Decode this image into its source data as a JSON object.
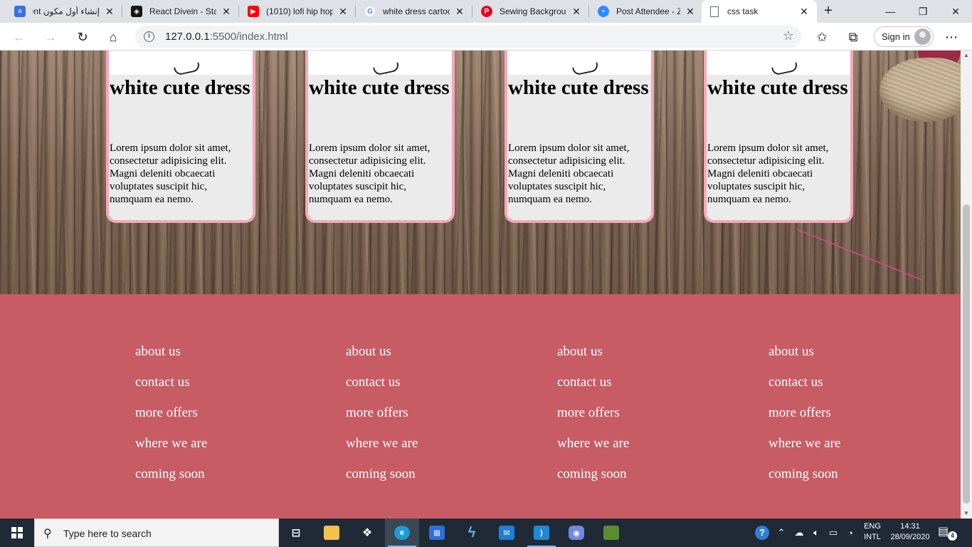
{
  "browser": {
    "tabs": [
      {
        "title": "إنشاء أول مكون ent",
        "icon": "form-builder-icon",
        "color": "#3b6fe0"
      },
      {
        "title": "React Divein - Star",
        "icon": "codesandbox-icon",
        "color": "#151515"
      },
      {
        "title": "(1010) lofi hip hop",
        "icon": "youtube-icon",
        "color": "#ff0000"
      },
      {
        "title": "white dress cartoo",
        "icon": "google-icon",
        "color": "#4285f4"
      },
      {
        "title": "Sewing Backgroun",
        "icon": "pinterest-icon",
        "color": "#e60023"
      },
      {
        "title": "Post Attendee - Zo",
        "icon": "zoom-icon",
        "color": "#2d8cff"
      },
      {
        "title": "css task",
        "icon": "document-icon",
        "color": "#5f6368"
      }
    ],
    "active_tab": 6,
    "address": {
      "host": "127.0.0.1",
      "rest": ":5500/index.html"
    },
    "signin_label": "Sign in"
  },
  "page": {
    "cards": [
      {
        "title": "white cute dress",
        "body": "Lorem ipsum dolor sit amet, consectetur adipisicing elit. Magni deleniti obcaecati voluptates suscipit hic, numquam ea nemo."
      },
      {
        "title": "white cute dress",
        "body": "Lorem ipsum dolor sit amet, consectetur adipisicing elit. Magni deleniti obcaecati voluptates suscipit hic, numquam ea nemo."
      },
      {
        "title": "white cute dress",
        "body": "Lorem ipsum dolor sit amet, consectetur adipisicing elit. Magni deleniti obcaecati voluptates suscipit hic, numquam ea nemo."
      },
      {
        "title": "white cute dress",
        "body": "Lorem ipsum dolor sit amet, consectetur adipisicing elit. Magni deleniti obcaecati voluptates suscipit hic, numquam ea nemo."
      }
    ],
    "footer_columns": [
      [
        "about us",
        "contact us",
        "more offers",
        "where we are",
        "coming soon"
      ],
      [
        "about us",
        "contact us",
        "more offers",
        "where we are",
        "coming soon"
      ],
      [
        "about us",
        "contact us",
        "more offers",
        "where we are",
        "coming soon"
      ],
      [
        "about us",
        "contact us",
        "more offers",
        "where we are",
        "coming soon"
      ]
    ],
    "colors": {
      "footer": "#c75c65",
      "card_border": "#f3a9ba",
      "card_bg": "#ebebeb"
    }
  },
  "taskbar": {
    "search_placeholder": "Type here to search",
    "apps": [
      {
        "icon": "task-view-icon",
        "color": "#1f2a36"
      },
      {
        "icon": "file-explorer-icon",
        "color": "#f2c14e"
      },
      {
        "icon": "dropbox-icon",
        "color": "#1f2a36"
      },
      {
        "icon": "edge-icon",
        "color": "#1f9bd8"
      },
      {
        "icon": "microsoft-store-icon",
        "color": "#2f6fd6"
      },
      {
        "icon": "visual-studio-icon",
        "color": "#1f2a36"
      },
      {
        "icon": "mail-icon",
        "color": "#1e7fd6"
      },
      {
        "icon": "vscode-icon",
        "color": "#1f8ad2"
      },
      {
        "icon": "discord-icon",
        "color": "#7289da"
      },
      {
        "icon": "minecraft-icon",
        "color": "#5b8c32"
      }
    ],
    "lang_line1": "ENG",
    "lang_line2": "INTL",
    "time": "14:31",
    "date": "28/09/2020",
    "notifications": "4"
  }
}
